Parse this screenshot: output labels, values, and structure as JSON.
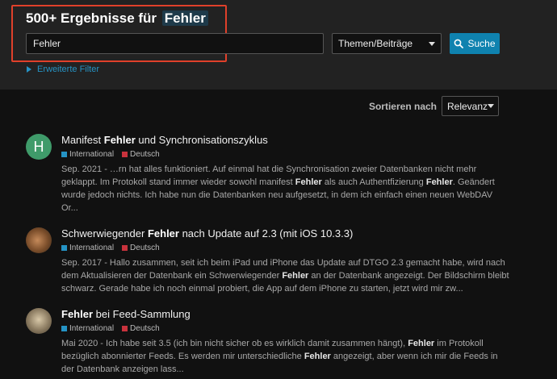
{
  "header": {
    "title_prefix": "500+ Ergebnisse für",
    "title_term": "Fehler",
    "search_value": "Fehler",
    "type_select": "Themen/Beiträge",
    "search_button": "Suche",
    "advanced_filter": "Erweiterte Filter"
  },
  "sort": {
    "label": "Sortieren nach",
    "value": "Relevanz"
  },
  "tags": {
    "international": {
      "label": "International",
      "color": "#2593c4"
    },
    "deutsch": {
      "label": "Deutsch",
      "color": "#c8323c"
    }
  },
  "results": [
    {
      "avatar_letter": "H",
      "title_before": "Manifest ",
      "title_em": "Fehler",
      "title_after": " und Synchronisationszyklus",
      "excerpt_parts": [
        "Sep. 2021 - …rn hat alles funktioniert. Auf einmal hat die Synchronisation zweier Datenbanken nicht mehr geklappt. Im Protokoll stand immer wieder sowohl manifest ",
        "Fehler",
        " als auch Authentfizierung ",
        "Fehler",
        ". Geändert wurde jedoch nichts. Ich habe nun die Datenbanken neu aufgesetzt, in dem ich einfach einen neuen WebDAV Or..."
      ]
    },
    {
      "title_before": "Schwerwiegender ",
      "title_em": "Fehler",
      "title_after": " nach Update auf 2.3 (mit iOS 10.3.3)",
      "excerpt_parts": [
        "Sep. 2017 - Hallo zusammen, seit ich beim iPad und iPhone das Update auf DTGO 2.3 gemacht habe, wird nach dem Aktualisieren der Datenbank ein Schwerwiegender ",
        "Fehler",
        " an der Datenbank angezeigt. Der Bildschirm bleibt schwarz. Gerade habe ich noch einmal probiert, die App auf dem iPhone zu starten, jetzt wird mir zw..."
      ]
    },
    {
      "title_before": "",
      "title_em": "Fehler",
      "title_after": " bei Feed-Sammlung",
      "excerpt_parts": [
        "Mai 2020 - Ich habe seit 3.5 (ich bin nicht sicher ob es wirklich damit zusammen hängt), ",
        "Fehler",
        " im Protokoll bezüglich abonnierter Feeds. Es werden mir unterschiedliche ",
        "Fehler",
        " angezeigt, aber wenn ich mir die Feeds in der Datenbank anzeigen lass..."
      ]
    }
  ]
}
